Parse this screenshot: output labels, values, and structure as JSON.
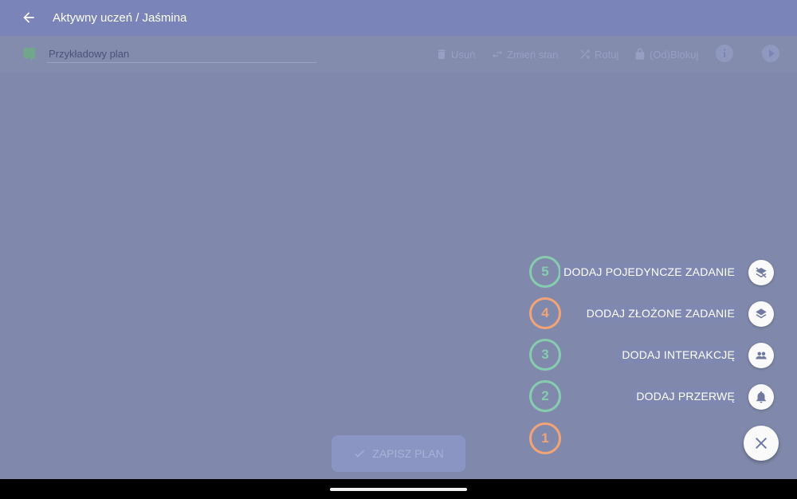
{
  "appbar": {
    "title": "Aktywny uczeń / Jaśmina",
    "back_icon": "arrow-left-icon"
  },
  "toolbar": {
    "plan_name_value": "Przykładowy plan",
    "actions": {
      "delete": "Usuń",
      "change_state": "Zmień stan",
      "shuffle": "Rotuj",
      "lock": "(Od)Blokuj"
    }
  },
  "fab_menu": {
    "items": [
      {
        "number": "5",
        "label": "DODAJ POJEDYNCZE ZADANIE",
        "icon": "layers-off-icon",
        "badge_color": "#86cdb0"
      },
      {
        "number": "4",
        "label": "DODAJ ZŁOŻONE ZADANIE",
        "icon": "layers-icon",
        "badge_color": "#f2a477"
      },
      {
        "number": "3",
        "label": "DODAJ INTERAKCJĘ",
        "icon": "people-icon",
        "badge_color": "#86cdb0"
      },
      {
        "number": "2",
        "label": "DODAJ PRZERWĘ",
        "icon": "bell-icon",
        "badge_color": "#86cdb0"
      },
      {
        "number": "1",
        "label": "",
        "icon": "",
        "badge_color": "#f2a477"
      }
    ],
    "close_icon": "close-icon"
  },
  "save_button": {
    "label": "ZAPISZ PLAN",
    "icon": "check-icon"
  },
  "colors": {
    "appbar": "#7a84b8",
    "overlay": "#8089ab",
    "accent_green": "#86cdb0",
    "accent_orange": "#f2a477"
  }
}
